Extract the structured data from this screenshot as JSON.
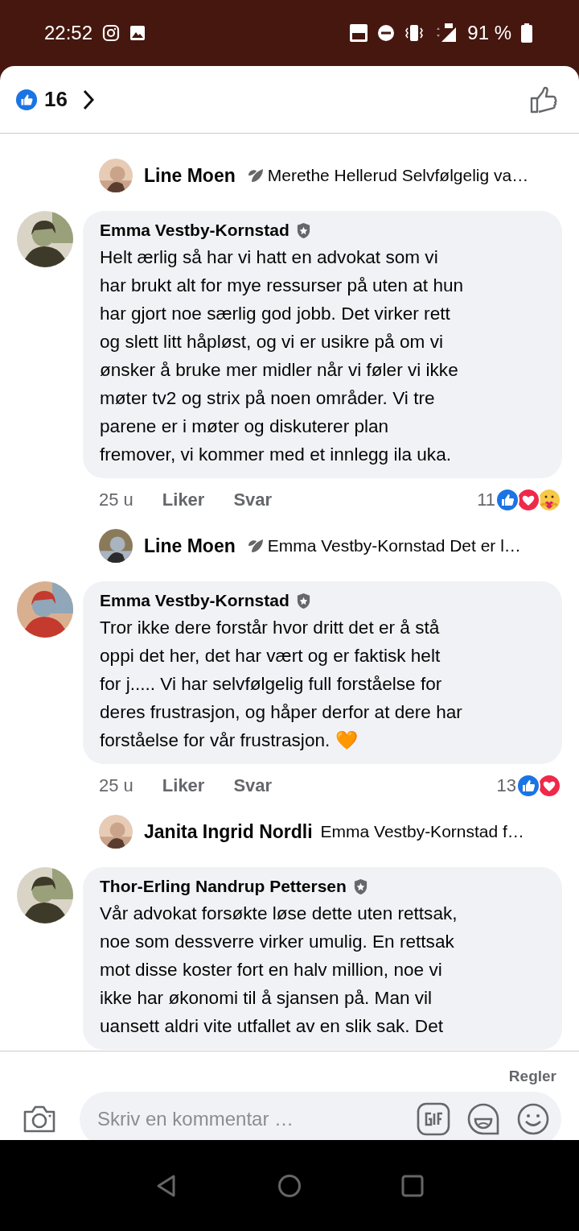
{
  "status_bar": {
    "time": "22:52",
    "battery": "91 %"
  },
  "header": {
    "like_count": "16"
  },
  "items": [
    {
      "kind": "reply",
      "name": "Line Moen",
      "leaf_badge": true,
      "snippet": "Merethe Hellerud Selvfølgelig va…"
    },
    {
      "kind": "comment",
      "name": "Emma Vestby-Kornstad",
      "text": "Helt ærlig så har vi hatt en advokat som vi\nhar brukt alt for mye ressurser på uten at hun\nhar gjort noe særlig god jobb. Det virker rett\nog slett litt håpløst, og vi er usikre på om vi\nønsker å bruke mer midler når vi føler vi ikke\nmøter tv2 og strix på noen områder. Vi tre\nparene er i møter og diskuterer plan\nfremover, vi kommer med et innlegg ila uka.",
      "time": "25 u",
      "like": "Liker",
      "reply": "Svar",
      "reaction_count": "11",
      "reactions": [
        {
          "kind": "like"
        },
        {
          "kind": "love"
        },
        {
          "kind": "care"
        }
      ]
    },
    {
      "kind": "reply",
      "name": "Line Moen",
      "leaf_badge": true,
      "snippet": "Emma Vestby-Kornstad Det er l…"
    },
    {
      "kind": "comment",
      "name": "Emma Vestby-Kornstad",
      "text": "Tror ikke dere forstår hvor dritt det er å stå\noppi det her, det har vært og er faktisk helt\nfor j..... Vi har selvfølgelig full forståelse for\nderes frustrasjon, og håper derfor at dere har\nforståelse for vår frustrasjon. 🧡",
      "time": "25 u",
      "like": "Liker",
      "reply": "Svar",
      "reaction_count": "13",
      "reactions": [
        {
          "kind": "like"
        },
        {
          "kind": "love"
        }
      ]
    },
    {
      "kind": "reply",
      "name": "Janita Ingrid Nordli",
      "leaf_badge": false,
      "snippet": "Emma Vestby-Kornstad f…"
    },
    {
      "kind": "comment",
      "name": "Thor-Erling Nandrup Pettersen",
      "text": "Vår advokat forsøkte løse dette uten rettsak,\nnoe som dessverre virker umulig. En rettsak\nmot disse koster fort en halv million, noe vi\nikke har økonomi til å sjansen på. Man vil\nuansett aldri vite utfallet av en slik sak. Det"
    }
  ],
  "footer": {
    "rules": "Regler",
    "placeholder": "Skriv en kommentar …"
  }
}
